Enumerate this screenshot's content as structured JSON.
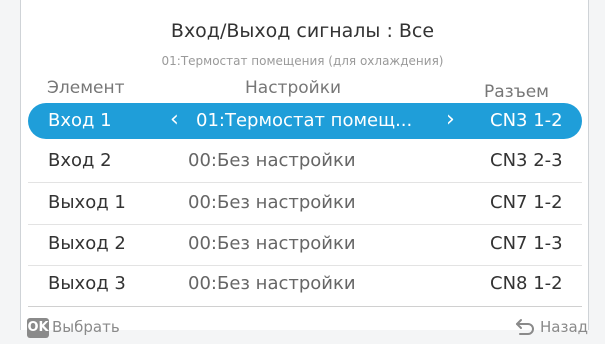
{
  "header": {
    "title": "Вход/Выход сигналы : Все",
    "subtitle": "01:Термостат помещения (для охлаждения)"
  },
  "columns": {
    "element": "Элемент",
    "settings": "Настройки",
    "port": "Разъем"
  },
  "rows": [
    {
      "name": "Вход 1",
      "setting": "01:Термостат помещ...",
      "port": "CN3 1-2",
      "selected": true
    },
    {
      "name": "Вход 2",
      "setting": "00:Без настройки",
      "port": "CN3 2-3",
      "selected": false
    },
    {
      "name": "Выход 1",
      "setting": "00:Без настройки",
      "port": "CN7 1-2",
      "selected": false
    },
    {
      "name": "Выход 2",
      "setting": "00:Без настройки",
      "port": "CN7 1-3",
      "selected": false
    },
    {
      "name": "Выход 3",
      "setting": "00:Без настройки",
      "port": "CN8 1-2",
      "selected": false
    }
  ],
  "footer": {
    "ok_badge": "OK",
    "ok_label": "Выбрать",
    "back_label": "Назад"
  },
  "colors": {
    "selection": "#1f9ed9",
    "badge": "#8a8a8a"
  },
  "icons": {
    "selector_left": "‹",
    "selector_right": "›",
    "back": "back-arrow-icon"
  }
}
